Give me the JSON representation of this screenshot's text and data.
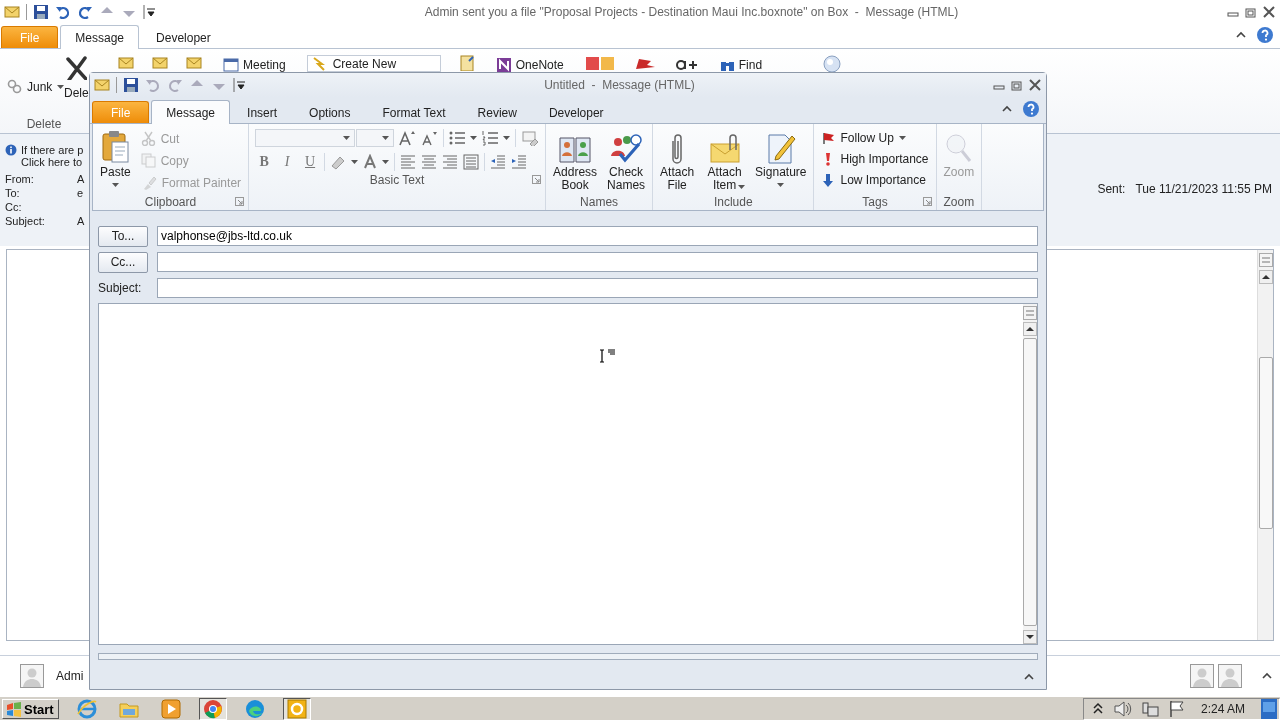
{
  "main_window": {
    "title": "Admin sent you a file \"Proposal Projects - Destination Maui Inc.boxnote\" on Box  -  Message (HTML)",
    "tabs": [
      {
        "kind": "file",
        "label": "File",
        "selected": false
      },
      {
        "kind": "tab",
        "label": "Message",
        "selected": true
      },
      {
        "kind": "tab",
        "label": "Developer",
        "selected": false
      }
    ],
    "ribbon": {
      "junk": "Junk",
      "delete": "Dele",
      "meeting": "Meeting",
      "quick_step": "Create New",
      "onenote": "OneNote",
      "find": "Find",
      "group": "Delete"
    },
    "info_bar": [
      "If there are p",
      "Click here to"
    ],
    "header": [
      {
        "label": "From:",
        "value": "A"
      },
      {
        "label": "To:",
        "value": "e"
      },
      {
        "label": "Cc:"
      },
      {
        "label": "Subject:",
        "value": "A"
      }
    ],
    "sent": {
      "label": "Sent:",
      "value": "Tue 11/21/2023 11:55 PM"
    },
    "people_pane": {
      "name": "Admi"
    }
  },
  "compose_window": {
    "title": "Untitled  -  Message (HTML)",
    "tabs": [
      {
        "kind": "file",
        "label": "File",
        "selected": false
      },
      {
        "kind": "tab",
        "label": "Message",
        "selected": true
      },
      {
        "kind": "tab",
        "label": "Insert",
        "selected": false
      },
      {
        "kind": "tab",
        "label": "Options",
        "selected": false
      },
      {
        "kind": "tab",
        "label": "Format Text",
        "selected": false
      },
      {
        "kind": "tab",
        "label": "Review",
        "selected": false
      },
      {
        "kind": "tab",
        "label": "Developer",
        "selected": false
      }
    ],
    "ribbon_groups": [
      {
        "kind": "buttons",
        "label": "Clipboard",
        "launcher": true,
        "items": [
          {
            "kind": "large",
            "label": "Paste",
            "dropdown": true,
            "disabled": false
          },
          {
            "kind": "small",
            "label": "Cut",
            "dropdown": false,
            "disabled": true
          },
          {
            "kind": "small",
            "label": "Copy",
            "dropdown": false,
            "disabled": true
          },
          {
            "kind": "small",
            "label": "Format Painter",
            "dropdown": false,
            "disabled": true
          }
        ]
      },
      {
        "kind": "format",
        "label": "Basic Text",
        "launcher": true,
        "format_buttons": [
          "B",
          "I",
          "U"
        ]
      },
      {
        "kind": "buttons",
        "label": "Names",
        "launcher": false,
        "items": [
          {
            "kind": "large",
            "label": "Address Book",
            "dropdown": false,
            "disabled": false
          },
          {
            "kind": "large",
            "label": "Check Names",
            "dropdown": false,
            "disabled": false
          }
        ]
      },
      {
        "kind": "buttons",
        "label": "Include",
        "launcher": false,
        "items": [
          {
            "kind": "large",
            "label": "Attach File",
            "dropdown": false,
            "disabled": false
          },
          {
            "kind": "large",
            "label": "Attach Item",
            "dropdown": true,
            "disabled": false
          },
          {
            "kind": "large",
            "label": "Signature",
            "dropdown": true,
            "disabled": false
          }
        ]
      },
      {
        "kind": "buttons",
        "label": "Tags",
        "launcher": true,
        "items": [
          {
            "kind": "small",
            "label": "Follow Up",
            "dropdown": true,
            "disabled": false
          },
          {
            "kind": "small",
            "label": "High Importance",
            "dropdown": false,
            "disabled": false
          },
          {
            "kind": "small",
            "label": "Low Importance",
            "dropdown": false,
            "disabled": false
          }
        ]
      },
      {
        "kind": "buttons",
        "label": "Zoom",
        "launcher": false,
        "items": [
          {
            "kind": "large",
            "label": "Zoom",
            "dropdown": false,
            "disabled": true
          }
        ]
      }
    ],
    "fields": [
      {
        "kind": "button",
        "label": "To...",
        "value": "valphonse@jbs-ltd.co.uk"
      },
      {
        "kind": "button",
        "label": "Cc..."
      },
      {
        "kind": "label",
        "label": "Subject:"
      }
    ]
  },
  "taskbar": {
    "start": "Start",
    "apps": [
      {
        "active": false
      },
      {
        "active": false
      },
      {
        "active": false
      },
      {
        "active": true
      },
      {
        "active": false
      },
      {
        "active": true
      }
    ],
    "clock": "2:24 AM"
  }
}
